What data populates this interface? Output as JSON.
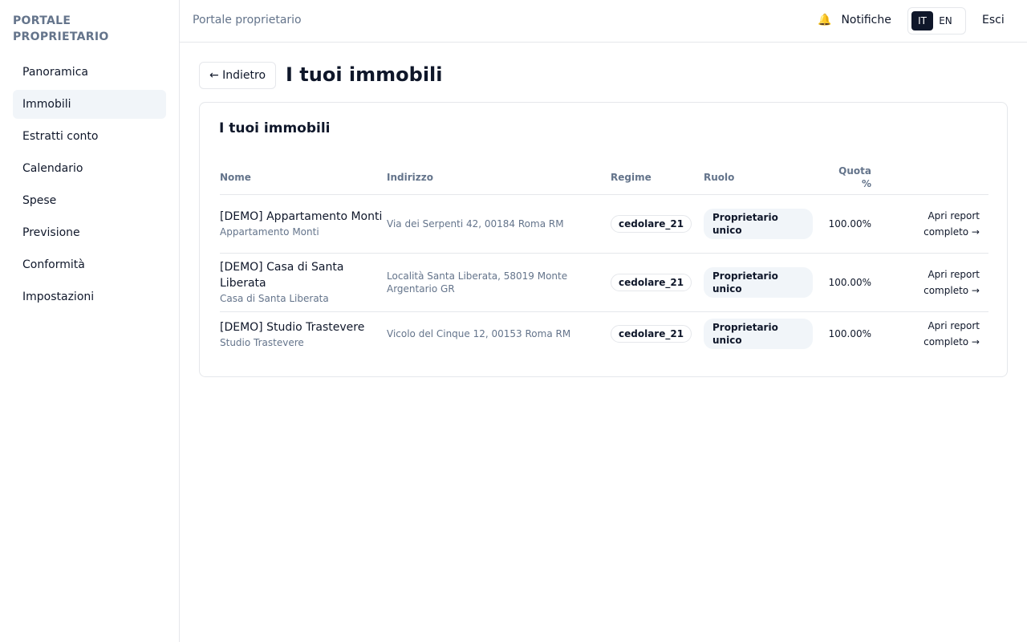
{
  "sidebar": {
    "brand_line1": "PORTALE",
    "brand_line2": "PROPRIETARIO",
    "items": [
      {
        "label": "Panoramica"
      },
      {
        "label": "Immobili"
      },
      {
        "label": "Estratti conto"
      },
      {
        "label": "Calendario"
      },
      {
        "label": "Spese"
      },
      {
        "label": "Previsione"
      },
      {
        "label": "Conformità"
      },
      {
        "label": "Impostazioni"
      }
    ],
    "active_index": 1
  },
  "topbar": {
    "title": "Portale proprietario",
    "notifications_label": "Notifiche",
    "lang_it": "IT",
    "lang_en": "EN",
    "active_lang": "IT",
    "logout_label": "Esci"
  },
  "page": {
    "back_label": "← Indietro",
    "title": "I tuoi immobili"
  },
  "card": {
    "title": "I tuoi immobili",
    "columns": {
      "name": "Nome",
      "address": "Indirizzo",
      "regime": "Regime",
      "role": "Ruolo",
      "quota_line1": "Quota",
      "quota_line2": "%"
    },
    "rows": [
      {
        "name": "[DEMO] Appartamento Monti",
        "subtitle": "Appartamento Monti",
        "address": "Via dei Serpenti 42, 00184 Roma RM",
        "regime": "cedolare_21",
        "role": "Proprietario unico",
        "quota": "100.00%",
        "report_line1": "Apri report",
        "report_line2": "completo →"
      },
      {
        "name": "[DEMO] Casa di Santa Liberata",
        "subtitle": "Casa di Santa Liberata",
        "address": "Località Santa Liberata, 58019 Monte Argentario GR",
        "regime": "cedolare_21",
        "role": "Proprietario unico",
        "quota": "100.00%",
        "report_line1": "Apri report",
        "report_line2": "completo →"
      },
      {
        "name": "[DEMO] Studio Trastevere",
        "subtitle": "Studio Trastevere",
        "address": "Vicolo del Cinque 12, 00153 Roma RM",
        "regime": "cedolare_21",
        "role": "Proprietario unico",
        "quota": "100.00%",
        "report_line1": "Apri report",
        "report_line2": "completo →"
      }
    ]
  },
  "icons": {
    "notifications": "bell-icon"
  },
  "colors": {
    "text": "#0f172a",
    "muted": "#64748b",
    "border": "#e5e7eb",
    "active_bg": "#f1f5f9",
    "lang_active_bg": "#0f172a",
    "bell": "#eab308"
  }
}
